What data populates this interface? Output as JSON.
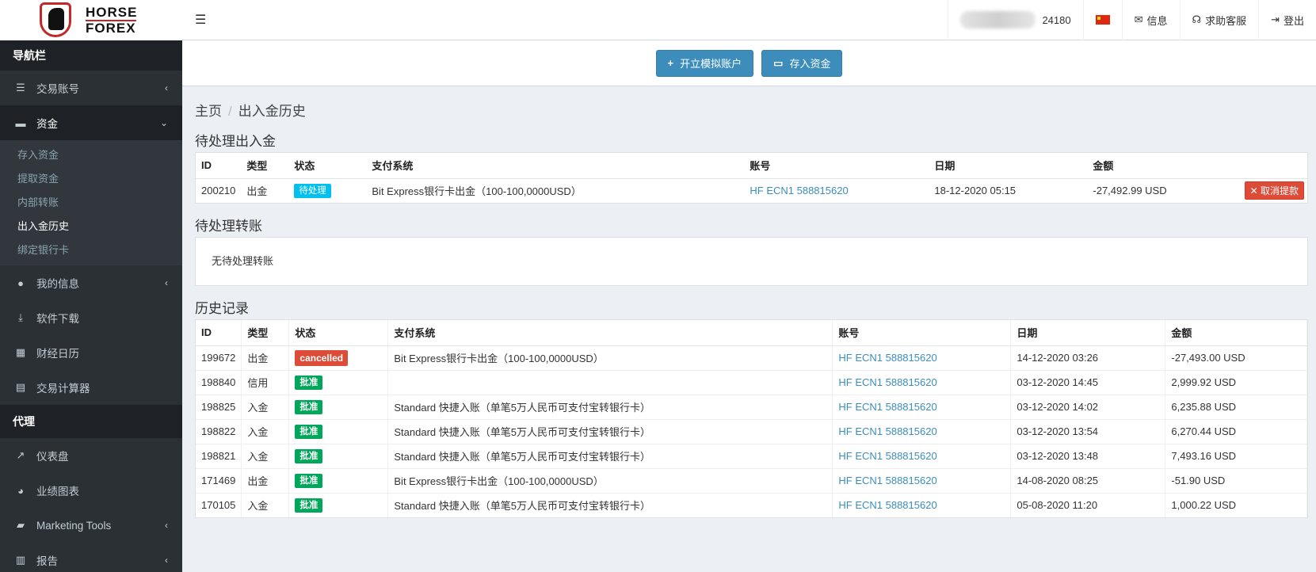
{
  "logo": {
    "line1": "HORSE",
    "line2": "FOREX"
  },
  "sidebar": {
    "header": "导航栏",
    "items": [
      {
        "label": "交易账号",
        "icon": "list-icon"
      },
      {
        "label": "资金",
        "icon": "wallet-icon"
      }
    ],
    "funds_sub": [
      "存入资金",
      "提取资金",
      "内部转账",
      "出入金历史",
      "绑定银行卡"
    ],
    "items2": [
      {
        "label": "我的信息",
        "icon": "user-icon"
      },
      {
        "label": "软件下载",
        "icon": "download-icon"
      },
      {
        "label": "财经日历",
        "icon": "calendar-icon"
      },
      {
        "label": "交易计算器",
        "icon": "calculator-icon"
      }
    ],
    "agent_title": "代理",
    "agent_items": [
      {
        "label": "仪表盘",
        "icon": "line-chart-icon"
      },
      {
        "label": "业绩图表",
        "icon": "pie-chart-icon"
      },
      {
        "label": "Marketing Tools",
        "icon": "briefcase-icon"
      },
      {
        "label": "报告",
        "icon": "bar-chart-icon"
      }
    ]
  },
  "topbar": {
    "user_id_tail": "24180",
    "messages": "信息",
    "support": "求助客服",
    "logout": "登出"
  },
  "actions": {
    "open_demo": "开立模拟账户",
    "deposit": "存入资金"
  },
  "breadcrumb": {
    "home": "主页",
    "current": "出入金历史"
  },
  "pending": {
    "title": "待处理出入金",
    "columns": [
      "ID",
      "类型",
      "状态",
      "支付系统",
      "账号",
      "日期",
      "金额"
    ],
    "row": {
      "id": "200210",
      "type": "出金",
      "status": "待处理",
      "system": "Bit Express银行卡出金（100-100,0000USD）",
      "account": "HF ECN1 588815620",
      "date": "18-12-2020 05:15",
      "amount": "-27,492.99 USD",
      "cancel": "取消提款"
    }
  },
  "transfers": {
    "title": "待处理转账",
    "empty": "无待处理转账"
  },
  "history": {
    "title": "历史记录",
    "columns": [
      "ID",
      "类型",
      "状态",
      "支付系统",
      "账号",
      "日期",
      "金额"
    ],
    "rows": [
      {
        "id": "199672",
        "type": "出金",
        "status": "cancelled",
        "system": "Bit Express银行卡出金（100-100,0000USD）",
        "account": "HF ECN1 588815620",
        "date": "14-12-2020 03:26",
        "amount": "-27,493.00 USD"
      },
      {
        "id": "198840",
        "type": "信用",
        "status": "批准",
        "system": "",
        "account": "HF ECN1 588815620",
        "date": "03-12-2020 14:45",
        "amount": "2,999.92 USD"
      },
      {
        "id": "198825",
        "type": "入金",
        "status": "批准",
        "system": "Standard 快捷入账（单笔5万人民币可支付宝转银行卡）",
        "account": "HF ECN1 588815620",
        "date": "03-12-2020 14:02",
        "amount": "6,235.88 USD"
      },
      {
        "id": "198822",
        "type": "入金",
        "status": "批准",
        "system": "Standard 快捷入账（单笔5万人民币可支付宝转银行卡）",
        "account": "HF ECN1 588815620",
        "date": "03-12-2020 13:54",
        "amount": "6,270.44 USD"
      },
      {
        "id": "198821",
        "type": "入金",
        "status": "批准",
        "system": "Standard 快捷入账（单笔5万人民币可支付宝转银行卡）",
        "account": "HF ECN1 588815620",
        "date": "03-12-2020 13:48",
        "amount": "7,493.16 USD"
      },
      {
        "id": "171469",
        "type": "出金",
        "status": "批准",
        "system": "Bit Express银行卡出金（100-100,0000USD）",
        "account": "HF ECN1 588815620",
        "date": "14-08-2020 08:25",
        "amount": "-51.90 USD"
      },
      {
        "id": "170105",
        "type": "入金",
        "status": "批准",
        "system": "Standard 快捷入账（单笔5万人民币可支付宝转银行卡）",
        "account": "HF ECN1 588815620",
        "date": "05-08-2020 11:20",
        "amount": "1,000.22 USD"
      }
    ]
  }
}
